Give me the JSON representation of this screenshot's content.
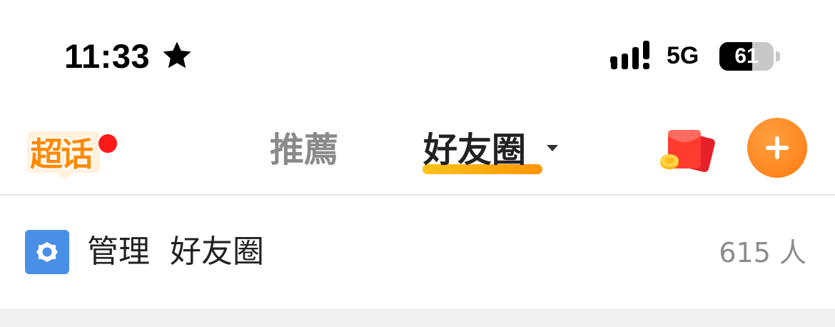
{
  "status_bar": {
    "time": "11:33",
    "star_icon": "star-icon",
    "signal_icon": "cellular-signal-icon",
    "network": "5G",
    "battery_level": "61",
    "battery_fraction": 0.61
  },
  "nav": {
    "logo_text": "超话",
    "logo_badge": "notification-dot",
    "tabs": [
      {
        "label": "推薦",
        "active": false
      },
      {
        "label": "好友圈",
        "active": true
      }
    ],
    "dropdown_icon": "caret-down-icon",
    "redpacket_icon": "red-envelope-icon",
    "add_icon": "plus-icon"
  },
  "manage_row": {
    "icon": "gear-icon",
    "action": "管理",
    "group": "好友圈",
    "count": "615 人"
  },
  "colors": {
    "accent_orange": "#ff8a00",
    "underline_start": "#ffc21a",
    "underline_end": "#ff9500",
    "badge_red": "#ff1a1a",
    "gear_blue": "#4a8fe7",
    "inactive_tab": "#8a8a8a",
    "divider": "#e6e6e6"
  }
}
